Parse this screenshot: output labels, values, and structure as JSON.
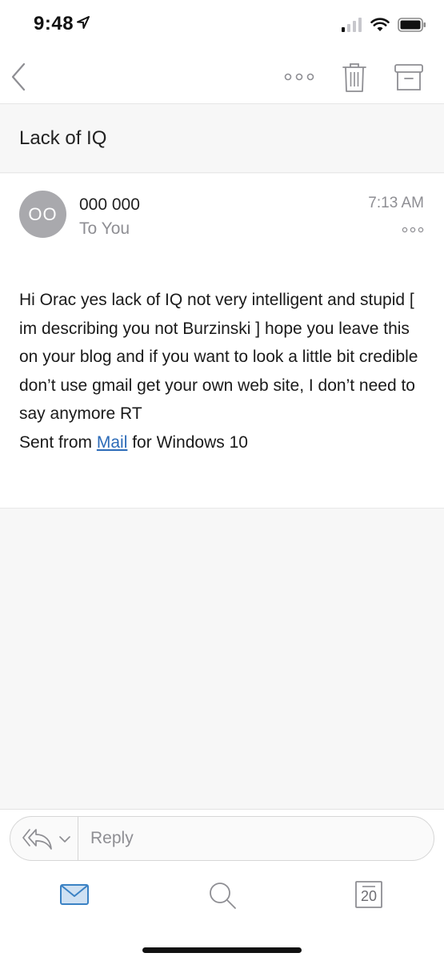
{
  "status_bar": {
    "time": "9:48",
    "icons": [
      "location-arrow-icon",
      "cellular-signal-icon",
      "wifi-icon",
      "battery-icon"
    ]
  },
  "nav": {
    "icons": [
      "back-chevron-icon",
      "more-options-icon",
      "trash-icon",
      "archive-icon"
    ]
  },
  "email": {
    "subject": "Lack of IQ",
    "sender": {
      "initials": "OO",
      "name": "000 000"
    },
    "recipient": "To You",
    "time": "7:13 AM",
    "body": {
      "text": "Hi Orac yes lack of IQ not very intelligent and stupid [ im describing you not Burzinski ] hope you leave this on your blog and if you want to look a little bit credible don’t use gmail get your own web site, I don’t need to say anymore RT",
      "signature_prefix": "Sent from ",
      "signature_link": "Mail",
      "signature_suffix": " for Windows 10"
    }
  },
  "reply": {
    "placeholder": "Reply"
  },
  "tab_bar": {
    "items": [
      "mail-icon",
      "search-icon",
      "calendar-icon"
    ],
    "calendar_day": "20"
  },
  "colors": {
    "accent": "#2c6bb8",
    "icon_gray": "#8e8e93",
    "avatar_bg": "#a9a9ad",
    "mail_tab_active": "#3b82c4"
  }
}
